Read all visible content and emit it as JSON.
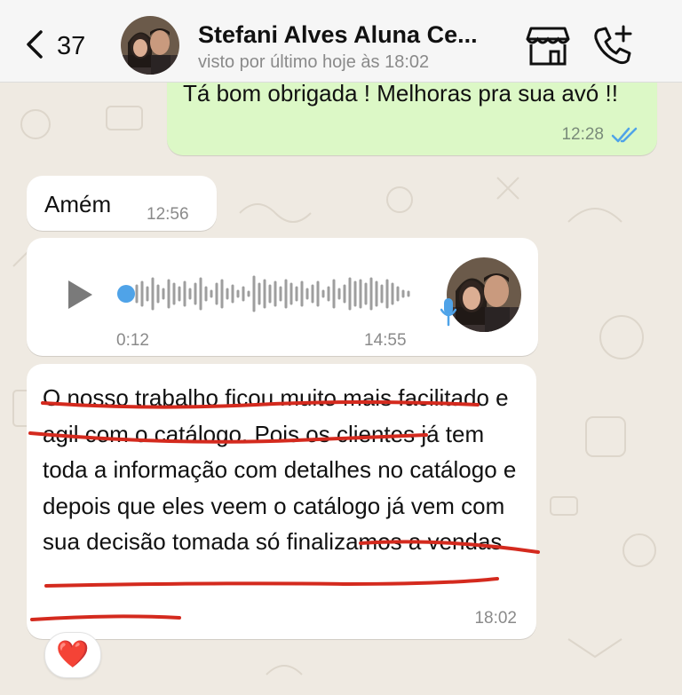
{
  "header": {
    "unread_count": "37",
    "contact_name": "Stefani Alves Aluna Ce...",
    "last_seen": "visto por último hoje às 18:02"
  },
  "messages": {
    "outgoing": {
      "text": "Tá bom obrigada ! Melhoras pra sua avó !!",
      "time": "12:28",
      "status": "read"
    },
    "amen": {
      "text": "Amém",
      "time": "12:56"
    },
    "voice": {
      "duration": "0:12",
      "time": "14:55"
    },
    "long": {
      "text": "O nosso trabalho ficou muito mais facilitado e agil com o catálogo. Pois os clientes já tem toda a informação com detalhes no catálogo e depois que eles veem o catálogo já vem com sua decisão tomada só finalizamos a vendas.",
      "time": "18:02",
      "reaction": "❤️"
    }
  },
  "colors": {
    "wallpaper": "#efeae2",
    "outgoing_bubble": "#dcf8c6",
    "read_ticks": "#4fa3e8",
    "annotation_red": "#d42a1e"
  }
}
